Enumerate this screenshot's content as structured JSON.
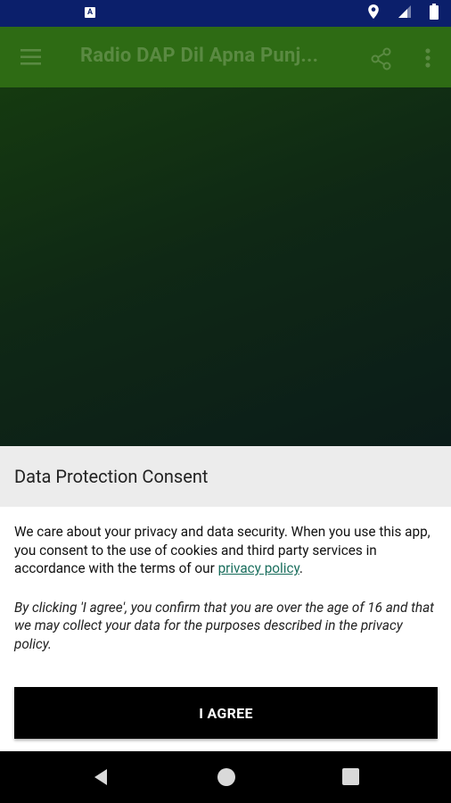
{
  "status_bar": {
    "notification_badge": "A",
    "icons": [
      "location-icon",
      "signal-icon",
      "battery-icon"
    ]
  },
  "toolbar": {
    "title": "Radio DAP Dil Apna Punj...",
    "menu_icon": "hamburger-menu-icon",
    "share_icon": "share-icon",
    "more_icon": "more-vert-icon"
  },
  "dialog": {
    "title": "Data Protection Consent",
    "body_text": "We care about your privacy and data security. When you use this app, you consent to the use of cookies and third party services in accordance with the terms of our ",
    "link_text": "privacy policy",
    "body_end": ".",
    "italic_text": "By clicking 'I agree', you confirm that you are over the age of 16 and that we may collect your data for the purposes described in the privacy policy.",
    "agree_label": "I AGREE"
  },
  "nav_bar": {
    "back": "back-icon",
    "home": "home-icon",
    "recents": "recents-icon"
  },
  "colors": {
    "status_bar": "#0b1f6b",
    "toolbar": "#2e6b14",
    "toolbar_title": "#5a8a42",
    "link": "#1a6e5d",
    "button": "#000000"
  }
}
